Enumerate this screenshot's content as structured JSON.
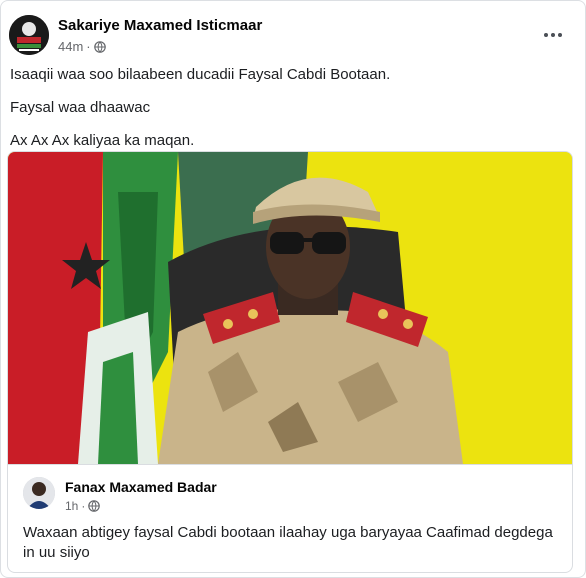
{
  "post": {
    "author": "Sakariye Maxamed Isticmaar",
    "time": "44m",
    "dot": "·",
    "audience_icon": "globe-icon",
    "more_icon": "more-options-icon",
    "lines": [
      "Isaaqii waa soo bilaabeen ducadii Faysal Cabdi Bootaan.",
      "Faysal waa dhaawac",
      "Ax Ax Ax kaliyaa ka maqan."
    ]
  },
  "shared_post": {
    "author": "Fanax Maxamed Badar",
    "time": "1h",
    "dot": "·",
    "audience_icon": "globe-icon",
    "text": "Waxaan abtigey faysal Cabdi bootaan ilaahay uga baryayaa Caafimad degdega in uu siiyo"
  },
  "colors": {
    "secondary_text": "#65676b",
    "border": "#dcdfe3",
    "photo_background": "#ece30f"
  }
}
